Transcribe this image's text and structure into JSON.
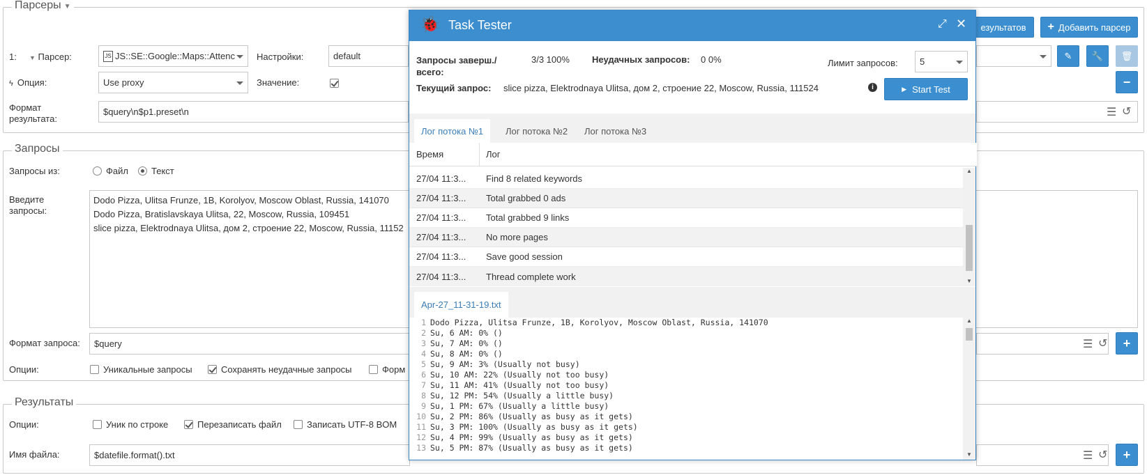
{
  "parsers": {
    "legend": "Парсеры",
    "index": "1:",
    "parser_label": "Парсер:",
    "parser_value": "JS::SE::Google::Maps::Attenc",
    "settings_label": "Настройки:",
    "settings_value": "default",
    "option_label": "Опция:",
    "option_value": "Use proxy",
    "value_label": "Значение:",
    "format_label": "Формат результата:",
    "format_value": "$query\\n$p1.preset\\n",
    "results_btn_label": "езультатов",
    "add_parser_label": "Добавить парсер"
  },
  "queries": {
    "legend": "Запросы",
    "from_label": "Запросы из:",
    "file_label": "Файл",
    "text_label": "Текст",
    "enter_label": "Введите запросы:",
    "lines": [
      "Dodo Pizza, Ulitsa Frunze, 1B, Korolyov, Moscow Oblast, Russia, 141070",
      "Dodo Pizza, Bratislavskaya Ulitsa, 22, Moscow, Russia, 109451",
      "slice pizza, Elektrodnaya Ulitsa, дом 2, строение 22, Moscow, Russia, 11152"
    ],
    "format_label": "Формат запроса:",
    "format_value": "$query",
    "options_label": "Опции:",
    "unique_label": "Уникальные запросы",
    "save_failed_label": "Сохранять неудачные запросы",
    "form_label": "Форм"
  },
  "results": {
    "legend": "Результаты",
    "options_label": "Опции:",
    "uniq_line_label": "Уник по строке",
    "overwrite_label": "Перезаписать файл",
    "utf8_label": "Записать UTF-8 BOM",
    "filename_label": "Имя файла:",
    "filename_value": "$datefile.format().txt"
  },
  "modal": {
    "title": "Task Tester",
    "done_label": "Запросы заверш./ всего:",
    "done_value": "3/3 100%",
    "failed_label": "Неудачных запросов:",
    "failed_value": "0 0%",
    "limit_label": "Лимит запросов:",
    "limit_value": "5",
    "current_label": "Текущий запрос:",
    "current_value": "slice pizza, Elektrodnaya Ulitsa, дом 2, строение 22, Moscow, Russia, 111524",
    "start_label": "Start Test",
    "tabs": [
      "Лог потока №1",
      "Лог потока №2",
      "Лог потока №3"
    ],
    "col_time": "Время",
    "col_log": "Лог",
    "log_rows": [
      {
        "time": "27/04 11:3...",
        "msg": "Find 8 related keywords"
      },
      {
        "time": "27/04 11:3...",
        "msg": "Total grabbed 0 ads"
      },
      {
        "time": "27/04 11:3...",
        "msg": "Total grabbed 9 links"
      },
      {
        "time": "27/04 11:3...",
        "msg": "No more pages"
      },
      {
        "time": "27/04 11:3...",
        "msg": "Save good session"
      },
      {
        "time": "27/04 11:3...",
        "msg": "Thread complete work"
      }
    ],
    "file_tab": "Apr-27_11-31-19.txt",
    "code_lines": [
      "Dodo Pizza, Ulitsa Frunze, 1B, Korolyov, Moscow Oblast, Russia, 141070",
      "Su, 6 AM: 0% ()",
      "Su, 7 AM: 0% ()",
      "Su, 8 AM: 0% ()",
      "Su, 9 AM: 3% (Usually not busy)",
      "Su, 10 AM: 22% (Usually not too busy)",
      "Su, 11 AM: 41% (Usually not too busy)",
      "Su, 12 PM: 54% (Usually a little busy)",
      "Su, 1 PM: 67% (Usually a little busy)",
      "Su, 2 PM: 86% (Usually as busy as it gets)",
      "Su, 3 PM: 100% (Usually as busy as it gets)",
      "Su, 4 PM: 99% (Usually as busy as it gets)",
      "Su, 5 PM: 87% (Usually as busy as it gets)"
    ],
    "line_numbers": [
      "1",
      "2",
      "3",
      "4",
      "5",
      "6",
      "7",
      "8",
      "9",
      "10",
      "11",
      "12",
      "13"
    ]
  },
  "icons": {
    "bug": "bug-icon",
    "expand": "expand-icon",
    "close": "close-icon",
    "info": "info-icon",
    "play": "play-icon",
    "edit": "pencil-icon",
    "wrench": "wrench-icon",
    "trash": "trash-icon",
    "minus": "minus-icon",
    "plus": "plus-icon",
    "list": "list-icon",
    "undo": "undo-icon",
    "bolt": "bolt-icon"
  },
  "colors": {
    "accent": "#3d8ecf",
    "link": "#3a7db8"
  }
}
